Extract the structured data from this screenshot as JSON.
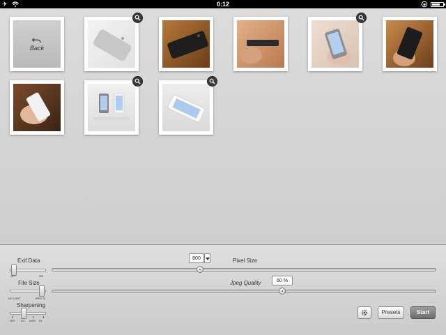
{
  "status_bar": {
    "time": "0:12"
  },
  "back_tile": {
    "label": "Back"
  },
  "thumbnails": [
    {
      "name": "phone-back-silver",
      "zoomable": true,
      "faded": true
    },
    {
      "name": "phone-black-table",
      "zoomable": false,
      "faded": false
    },
    {
      "name": "phone-in-hand-side",
      "zoomable": false,
      "faded": false
    },
    {
      "name": "phone-in-hand-front",
      "zoomable": true,
      "faded": true
    },
    {
      "name": "phone-black-back",
      "zoomable": false,
      "faded": false
    },
    {
      "name": "phone-white-in-hand",
      "zoomable": false,
      "faded": false
    },
    {
      "name": "phones-on-stand",
      "zoomable": true,
      "faded": true
    },
    {
      "name": "phone-white-front",
      "zoomable": true,
      "faded": true
    }
  ],
  "controls": {
    "exif": {
      "label": "Exif Data",
      "off": "OFF",
      "on": "ON",
      "value": "off"
    },
    "file_size": {
      "label": "File Size",
      "left": "NO LIMIT",
      "right": "JPEG %",
      "value": "jpeg"
    },
    "sharpening": {
      "label": "Sharpening",
      "stops": [
        "OFF",
        "LO",
        "MED",
        "HI"
      ],
      "value": "LO"
    },
    "pixel_size": {
      "label": "Pixel Size",
      "value": "800",
      "fraction": 0.385
    },
    "jpeg_quality": {
      "label": "Jpeg Quality",
      "value": "60 %",
      "fraction": 0.6
    },
    "buttons": {
      "presets": "Presets",
      "start": "Start"
    }
  },
  "colors": {
    "status_bar": "#000000",
    "start_button": "#7a7a7a",
    "panel": "#d6d6d6"
  }
}
